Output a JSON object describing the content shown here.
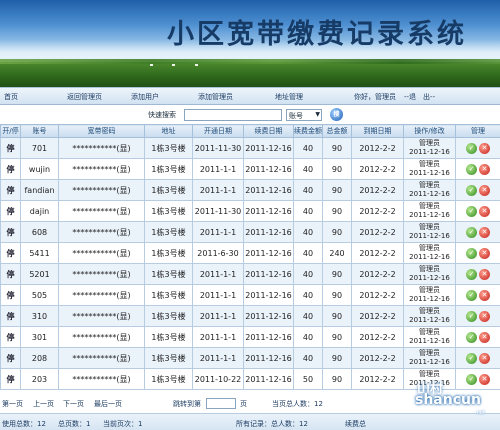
{
  "banner": {
    "title": "小区宽带缴费记录系统"
  },
  "nav": {
    "home": "首页",
    "back_admin": "返回管理页",
    "add_user": "添加用户",
    "add_admin": "添加管理员",
    "address_manage": "地址管理",
    "greeting": "你好，管理员",
    "logout": "--退　出--"
  },
  "search": {
    "label": "快速搜索",
    "value": "",
    "select_value": "账号",
    "go_label": "搜"
  },
  "table": {
    "headers": [
      "开/停",
      "账号",
      "宽带密码",
      "地址",
      "开通日期",
      "续费日期",
      "续费金额",
      "总金额",
      "到期日期",
      "操作/修改",
      "管理"
    ],
    "rows": [
      {
        "status": "停",
        "account": "701",
        "password": "***********(显)",
        "address": "1栋3号楼",
        "open": "2011-11-30",
        "renew": "2011-12-16",
        "renew_amount": "40",
        "total": "90",
        "expire": "2012-2-2",
        "op1": "管理员",
        "op2": "2011-12-16"
      },
      {
        "status": "停",
        "account": "wujin",
        "password": "***********(显)",
        "address": "1栋3号楼",
        "open": "2011-1-1",
        "renew": "2011-12-16",
        "renew_amount": "40",
        "total": "90",
        "expire": "2012-2-2",
        "op1": "管理员",
        "op2": "2011-12-16"
      },
      {
        "status": "停",
        "account": "fandian",
        "password": "***********(显)",
        "address": "1栋3号楼",
        "open": "2011-1-1",
        "renew": "2011-12-16",
        "renew_amount": "40",
        "total": "90",
        "expire": "2012-2-2",
        "op1": "管理员",
        "op2": "2011-12-16"
      },
      {
        "status": "停",
        "account": "dajin",
        "password": "***********(显)",
        "address": "1栋3号楼",
        "open": "2011-11-30",
        "renew": "2011-12-16",
        "renew_amount": "40",
        "total": "90",
        "expire": "2012-2-2",
        "op1": "管理员",
        "op2": "2011-12-16"
      },
      {
        "status": "停",
        "account": "608",
        "password": "***********(显)",
        "address": "1栋3号楼",
        "open": "2011-1-1",
        "renew": "2011-12-16",
        "renew_amount": "40",
        "total": "90",
        "expire": "2012-2-2",
        "op1": "管理员",
        "op2": "2011-12-16"
      },
      {
        "status": "停",
        "account": "5411",
        "password": "***********(显)",
        "address": "1栋3号楼",
        "open": "2011-6-30",
        "renew": "2011-12-16",
        "renew_amount": "40",
        "total": "240",
        "expire": "2012-2-2",
        "op1": "管理员",
        "op2": "2011-12-16"
      },
      {
        "status": "停",
        "account": "5201",
        "password": "***********(显)",
        "address": "1栋3号楼",
        "open": "2011-1-1",
        "renew": "2011-12-16",
        "renew_amount": "40",
        "total": "90",
        "expire": "2012-2-2",
        "op1": "管理员",
        "op2": "2011-12-16"
      },
      {
        "status": "停",
        "account": "505",
        "password": "***********(显)",
        "address": "1栋3号楼",
        "open": "2011-1-1",
        "renew": "2011-12-16",
        "renew_amount": "40",
        "total": "90",
        "expire": "2012-2-2",
        "op1": "管理员",
        "op2": "2011-12-16"
      },
      {
        "status": "停",
        "account": "310",
        "password": "***********(显)",
        "address": "1栋3号楼",
        "open": "2011-1-1",
        "renew": "2011-12-16",
        "renew_amount": "40",
        "total": "90",
        "expire": "2012-2-2",
        "op1": "管理员",
        "op2": "2011-12-16"
      },
      {
        "status": "停",
        "account": "301",
        "password": "***********(显)",
        "address": "1栋3号楼",
        "open": "2011-1-1",
        "renew": "2011-12-16",
        "renew_amount": "40",
        "total": "90",
        "expire": "2012-2-2",
        "op1": "管理员",
        "op2": "2011-12-16"
      },
      {
        "status": "停",
        "account": "208",
        "password": "***********(显)",
        "address": "1栋3号楼",
        "open": "2011-1-1",
        "renew": "2011-12-16",
        "renew_amount": "40",
        "total": "90",
        "expire": "2012-2-2",
        "op1": "管理员",
        "op2": "2011-12-16"
      },
      {
        "status": "停",
        "account": "203",
        "password": "***********(显)",
        "address": "1栋3号楼",
        "open": "2011-10-22",
        "renew": "2011-12-16",
        "renew_amount": "50",
        "total": "90",
        "expire": "2012-2-2",
        "op1": "管理员",
        "op2": "2011-12-16"
      }
    ]
  },
  "pager": {
    "first": "第一页",
    "prev": "上一页",
    "next": "下一页",
    "last": "最后一页",
    "jump_to": "跳转到第",
    "page_unit": "页",
    "current_total": "当页总人数：12"
  },
  "stats": {
    "total_users": "使用总数：12",
    "total_pages": "总页数：1",
    "current_page": "当前页次：1",
    "all_records": "所有记录：总人数：12",
    "renew_count": "续费总"
  },
  "watermark": {
    "brand": "shancun",
    "sub": ".net"
  },
  "colors": {
    "header_bg": "#c9dcef",
    "row_alt_bg": "#eaf2fa",
    "edit_icon": "#2f8a1e",
    "delete_icon": "#c4231b"
  }
}
